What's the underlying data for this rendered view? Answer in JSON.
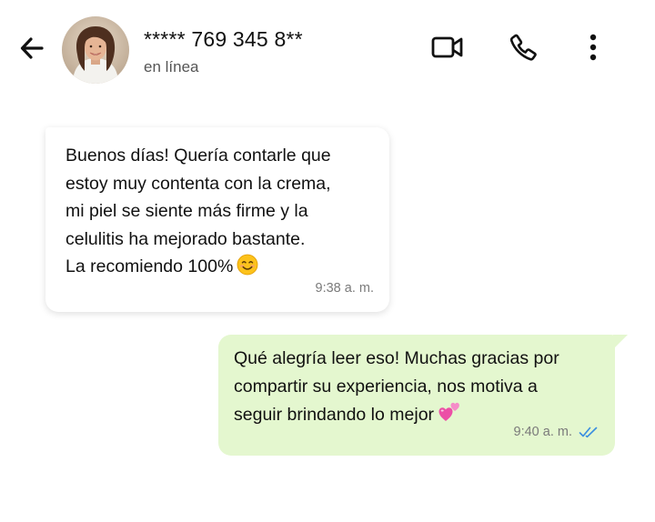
{
  "header": {
    "contact_name": "***** 769 345 8**",
    "status": "en línea",
    "icons": {
      "back": "arrow-left-icon",
      "video": "video-camera-icon",
      "call": "phone-icon",
      "menu": "more-vertical-icon"
    }
  },
  "messages": [
    {
      "direction": "incoming",
      "lines": [
        "Buenos días! Quería contarle que",
        "estoy muy contenta con la crema,",
        "mi piel se siente más firme y la",
        "celulitis ha mejorado bastante.",
        "La recomiendo 100%"
      ],
      "emoji": "smiling-face-icon",
      "time": "9:38 a. m."
    },
    {
      "direction": "outgoing",
      "lines": [
        "Qué alegría leer eso! Muchas gracias por",
        "compartir su experiencia, nos motiva a",
        "seguir brindando lo mejor"
      ],
      "emoji": "two-hearts-icon",
      "time": "9:40 a. m.",
      "status_icon": "double-check-read-icon"
    }
  ],
  "colors": {
    "outgoing_bubble": "#e4f7cf",
    "incoming_bubble": "#ffffff",
    "read_ticks": "#3b8fe0"
  }
}
